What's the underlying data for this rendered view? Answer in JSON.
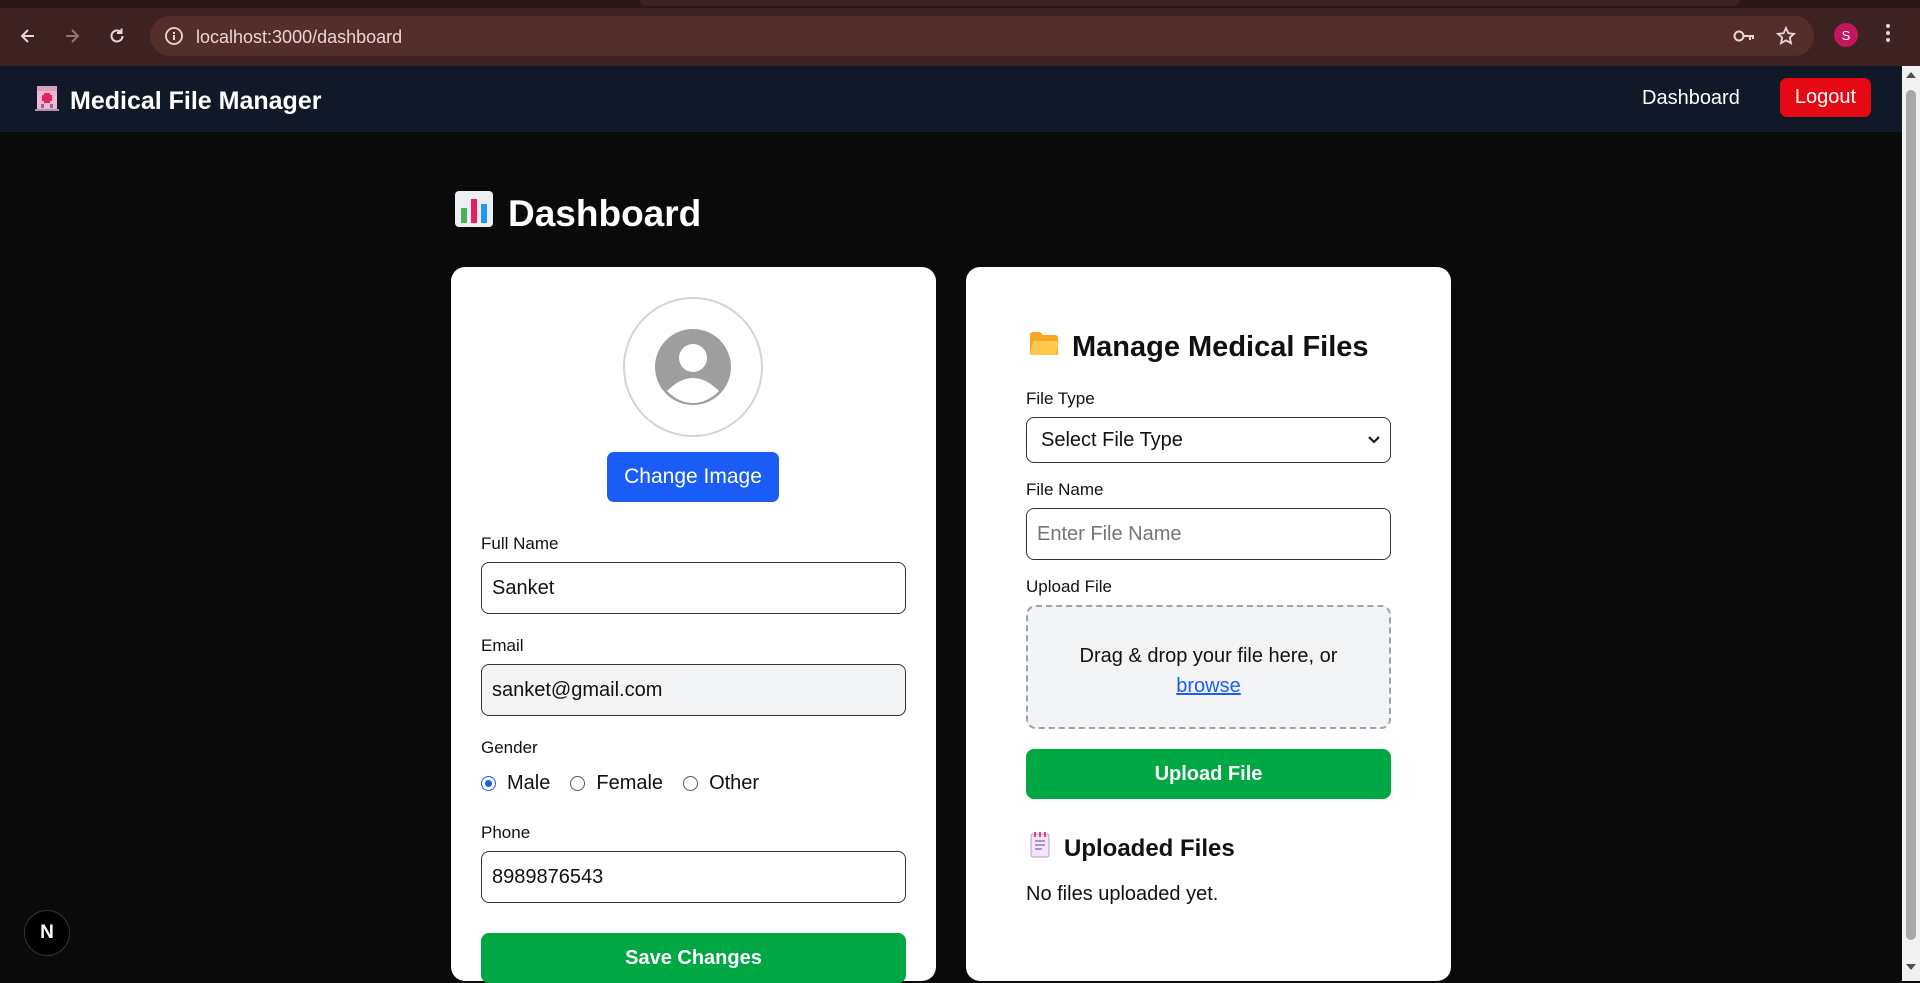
{
  "browser": {
    "url": "localhost:3000/dashboard",
    "profile_initial": "S"
  },
  "navbar": {
    "brand": "Medical File Manager",
    "brand_icon": "hospital-icon",
    "dashboard_link": "Dashboard",
    "logout_label": "Logout"
  },
  "page": {
    "title": "Dashboard",
    "title_icon": "bar-chart-icon"
  },
  "profile": {
    "change_image_label": "Change Image",
    "full_name_label": "Full Name",
    "full_name_value": "Sanket",
    "email_label": "Email",
    "email_value": "sanket@gmail.com",
    "gender_label": "Gender",
    "gender_options": [
      "Male",
      "Female",
      "Other"
    ],
    "gender_selected": "Male",
    "phone_label": "Phone",
    "phone_value": "8989876543",
    "save_label": "Save Changes"
  },
  "files": {
    "heading": "Manage Medical Files",
    "heading_icon": "folder-icon",
    "file_type_label": "File Type",
    "file_type_selected": "Select File Type",
    "file_name_label": "File Name",
    "file_name_placeholder": "Enter File Name",
    "upload_file_label": "Upload File",
    "drop_text": "Drag & drop your file here, or",
    "browse_text": "browse",
    "upload_button": "Upload File",
    "uploaded_heading": "Uploaded Files",
    "uploaded_icon": "notepad-icon",
    "empty_message": "No files uploaded yet."
  },
  "devtools_badge": "N",
  "colors": {
    "primary_blue": "#1a5cf6",
    "success_green": "#00a843",
    "logout_red": "#e50914",
    "navbar_bg": "#111827"
  }
}
